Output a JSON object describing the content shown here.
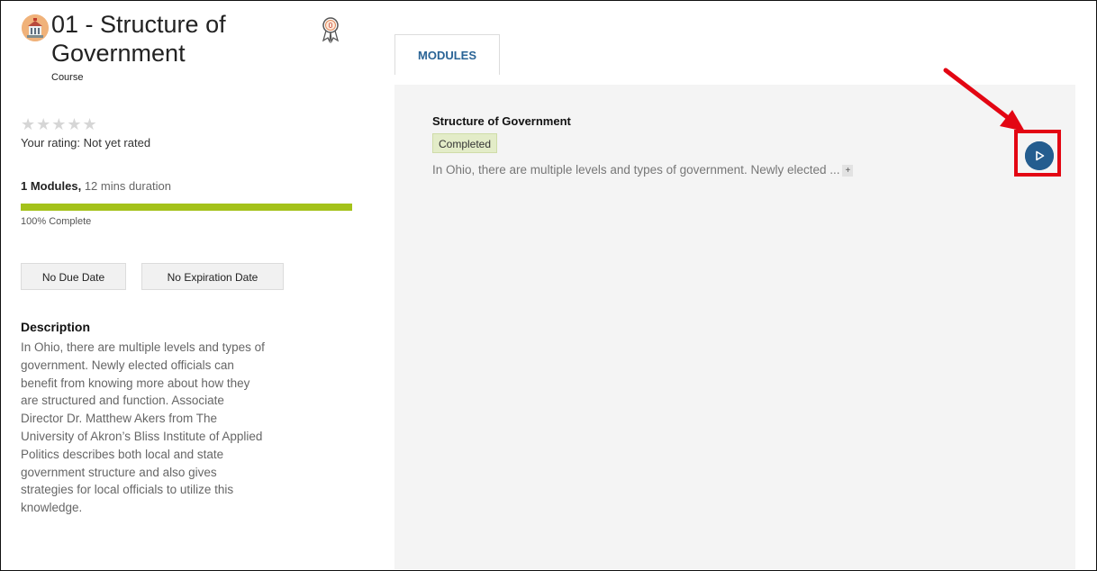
{
  "course": {
    "title": "01 - Structure of Government",
    "type": "Course",
    "icon": "capitol-building-icon",
    "badge_icon": "award-ribbon-icon",
    "badge_count": "0"
  },
  "rating": {
    "stars": "★★★★★",
    "text": "Your rating: Not yet rated"
  },
  "summary": {
    "modules_label": "1 Modules,",
    "duration_label": "12 mins duration",
    "progress_fraction": 1.0,
    "progress_text": "100% Complete"
  },
  "dates": {
    "due": "No Due Date",
    "expiration": "No Expiration Date"
  },
  "description": {
    "heading": "Description",
    "body": "In Ohio, there are multiple levels and types of government. Newly elected officials can benefit from knowing more about how they are structured and function. Associate Director Dr. Matthew Akers from The University of Akron’s Bliss Institute of Applied Politics describes both local and state government structure and also gives strategies for local officials to utilize this knowledge."
  },
  "tabs": [
    {
      "label": "MODULES"
    }
  ],
  "module": {
    "title": "Structure of Government",
    "status": "Completed",
    "description": "In Ohio, there are multiple levels and types of government. Newly elected ...",
    "more_label": "+",
    "action_icon": "play-icon"
  },
  "colors": {
    "accent": "#245d8f",
    "progress": "#a4c21a",
    "highlight": "#e30613",
    "completed_badge": "#e3ecc8"
  }
}
